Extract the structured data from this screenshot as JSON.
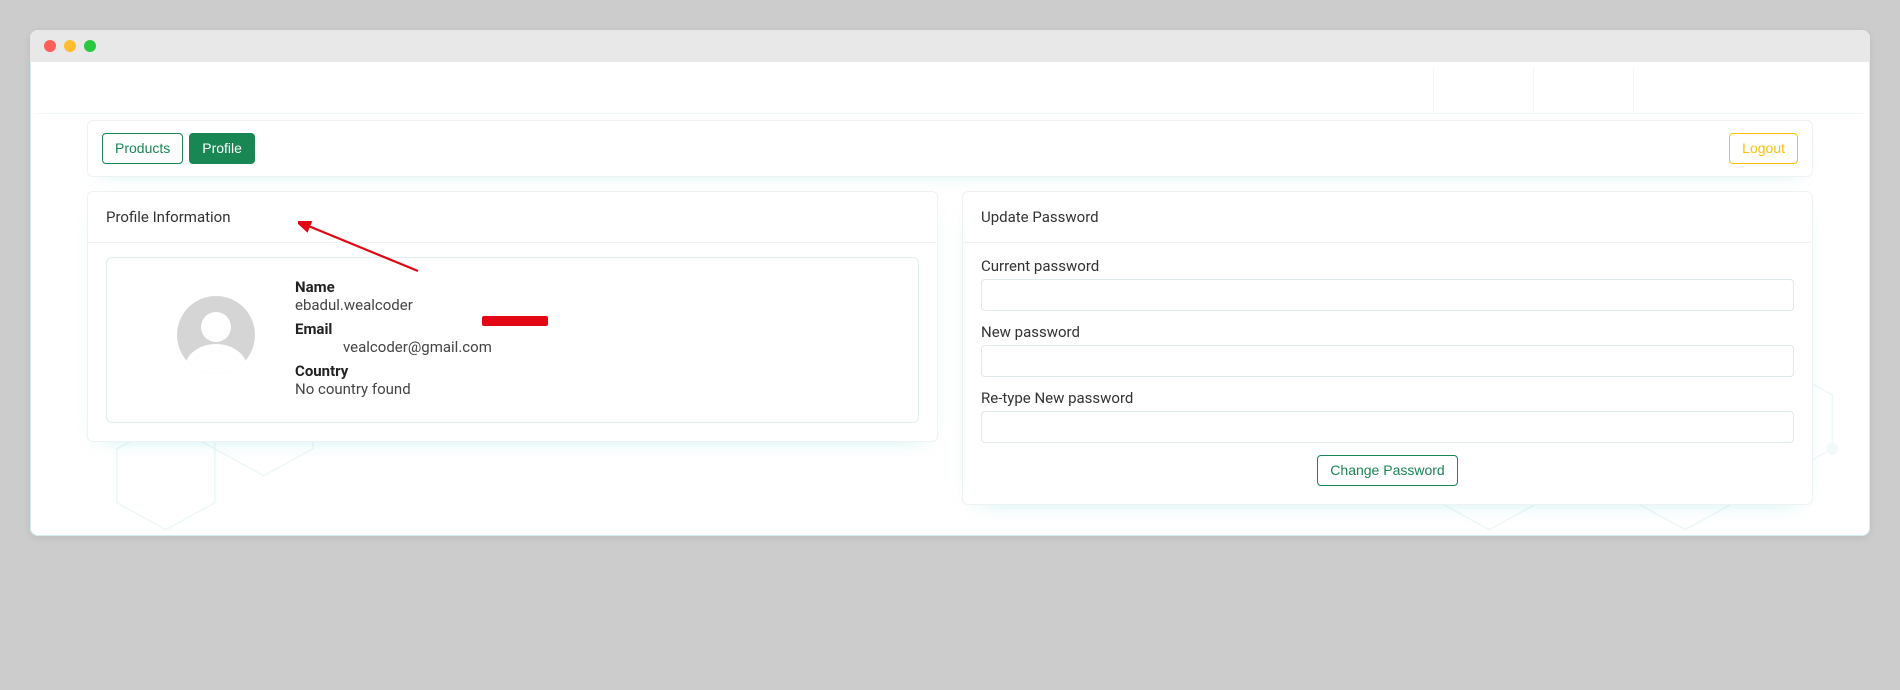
{
  "tabs": {
    "products": "Products",
    "profile": "Profile",
    "logout": "Logout"
  },
  "profile_card": {
    "title": "Profile Information",
    "fields": {
      "name_label": "Name",
      "name_value": "ebadul.wealcoder",
      "email_label": "Email",
      "email_value": "vealcoder@gmail.com",
      "country_label": "Country",
      "country_value": "No country found"
    }
  },
  "password_card": {
    "title": "Update Password",
    "current_label": "Current password",
    "new_label": "New password",
    "retype_label": "Re-type New password",
    "submit": "Change Password"
  }
}
